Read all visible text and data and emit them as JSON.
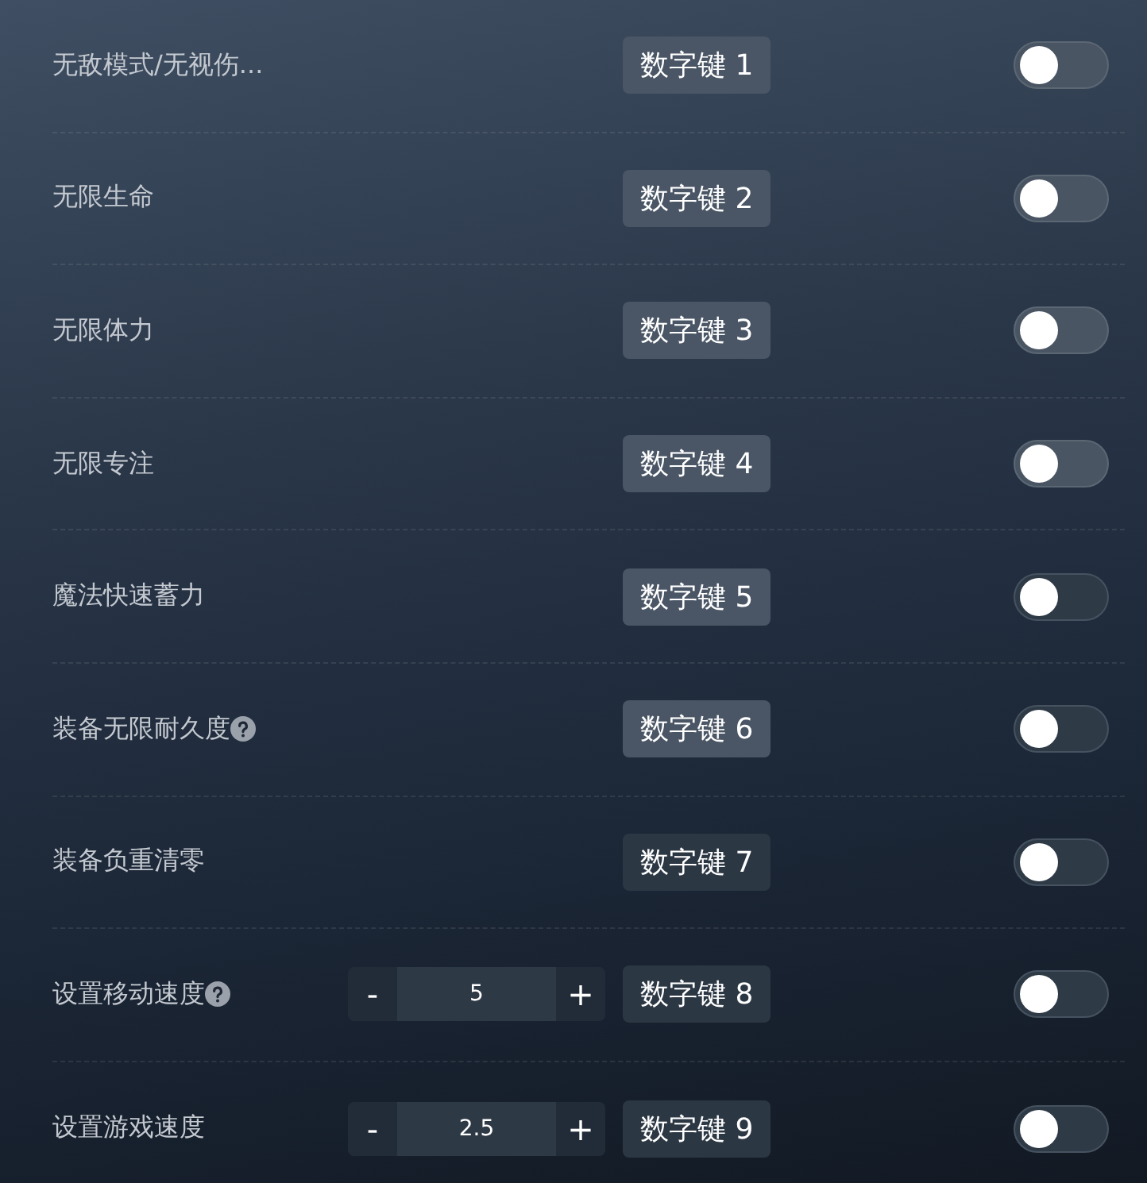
{
  "rows": [
    {
      "label": "无敌模式/无视伤...",
      "help": false,
      "key": "数字键 1",
      "on": false
    },
    {
      "label": "无限生命",
      "help": false,
      "key": "数字键 2",
      "on": false
    },
    {
      "label": "无限体力",
      "help": false,
      "key": "数字键 3",
      "on": false
    },
    {
      "label": "无限专注",
      "help": false,
      "key": "数字键 4",
      "on": false
    },
    {
      "label": "魔法快速蓄力",
      "help": false,
      "key": "数字键 5",
      "on": false
    },
    {
      "label": "装备无限耐久度",
      "help": true,
      "key": "数字键 6",
      "on": false
    },
    {
      "label": "装备负重清零",
      "help": false,
      "key": "数字键 7",
      "on": false
    },
    {
      "label": "设置移动速度",
      "help": true,
      "stepper": {
        "minus": "-",
        "value": "5",
        "plus": "+"
      },
      "key": "数字键 8",
      "on": false
    },
    {
      "label": "设置游戏速度",
      "help": false,
      "stepper": {
        "minus": "-",
        "value": "2.5",
        "plus": "+"
      },
      "key": "数字键 9",
      "on": false
    }
  ]
}
